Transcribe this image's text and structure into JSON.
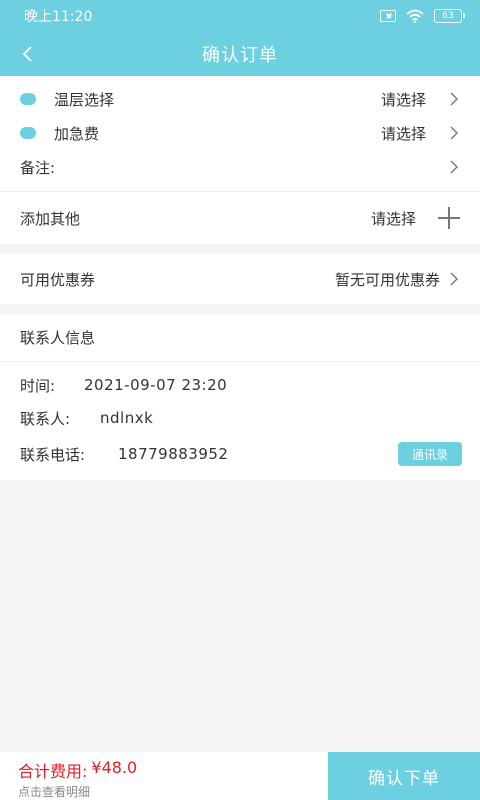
{
  "status_bar": {
    "time": "晚上11:20",
    "battery": "63"
  },
  "header": {
    "title": "确认订单"
  },
  "options": {
    "temperature": {
      "label": "温层选择",
      "value": "请选择"
    },
    "urgent": {
      "label": "加急费",
      "value": "请选择"
    },
    "remark": {
      "label": "备注:"
    },
    "other": {
      "label": "添加其他",
      "value": "请选择"
    }
  },
  "coupon": {
    "label": "可用优惠券",
    "value": "暂无可用优惠券"
  },
  "contact": {
    "section_title": "联系人信息",
    "time_label": "时间:",
    "time_value": "2021-09-07 23:20",
    "name_label": "联系人:",
    "name_value": "ndlnxk",
    "phone_label": "联系电话:",
    "phone_value": "18779883952",
    "contacts_button": "通讯录"
  },
  "footer": {
    "total_label": "合计费用:",
    "total_value": "¥48.0",
    "detail_link": "点击查看明细",
    "submit_label": "确认下单"
  },
  "colors": {
    "accent": "#6dd0e0",
    "price": "#e0202a"
  }
}
